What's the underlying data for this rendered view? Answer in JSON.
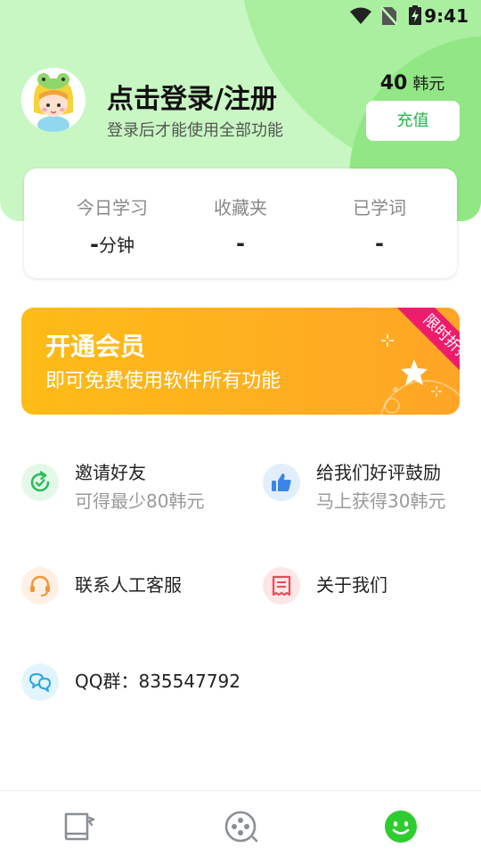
{
  "status_bar": {
    "time": "9:41"
  },
  "profile": {
    "title": "点击登录/注册",
    "subtitle": "登录后才能使用全部功能"
  },
  "balance": {
    "amount": "40",
    "unit": "韩元",
    "recharge_label": "充值"
  },
  "stats": [
    {
      "label": "今日学习",
      "value": "-",
      "unit": "分钟"
    },
    {
      "label": "收藏夹",
      "value": "-",
      "unit": ""
    },
    {
      "label": "已学词",
      "value": "-",
      "unit": ""
    }
  ],
  "vip": {
    "title": "开通会员",
    "subtitle": "即可免费使用软件所有功能",
    "ribbon": "限时折扣"
  },
  "menu": {
    "invite": {
      "label": "邀请好友",
      "sub": "可得最少80韩元"
    },
    "review": {
      "label": "给我们好评鼓励",
      "sub": "马上获得30韩元"
    },
    "service": {
      "label": "联系人工客服"
    },
    "about": {
      "label": "关于我们"
    },
    "qq": {
      "label": "QQ群：835547792"
    }
  },
  "colors": {
    "accent_green": "#27b24a",
    "header_green": "#c8f7c3",
    "vip_orange": "#fdbc16",
    "ribbon_pink": "#ee1c6c",
    "active_tab": "#2ecc2e"
  },
  "nav": {
    "active_tab": "profile"
  }
}
